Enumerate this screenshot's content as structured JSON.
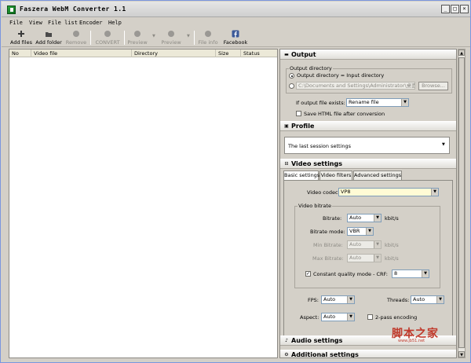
{
  "window": {
    "title": "Faszera WebM Converter 1.1",
    "controls": {
      "minimize": "_",
      "maximize": "□",
      "close": "×"
    }
  },
  "menu": [
    "File",
    "View",
    "File list",
    "Encoder",
    "Help"
  ],
  "toolbar": [
    {
      "label": "Add files",
      "icon": "plus-icon",
      "enabled": true
    },
    {
      "label": "Add folder",
      "icon": "folder-icon",
      "enabled": true
    },
    {
      "label": "Remove",
      "icon": "remove-icon",
      "enabled": false
    },
    {
      "label": "CONVERT",
      "icon": "convert-icon",
      "enabled": false
    },
    {
      "label": "Preview",
      "icon": "preview-icon",
      "enabled": false
    },
    {
      "label": "Preview",
      "icon": "preview-icon",
      "enabled": false
    },
    {
      "label": "File info",
      "icon": "info-icon",
      "enabled": false
    },
    {
      "label": "Facebook",
      "icon": "facebook-icon",
      "enabled": true
    }
  ],
  "filelist": {
    "columns": [
      "No",
      "Video file",
      "Directory",
      "Size",
      "Status"
    ]
  },
  "output": {
    "title": "Output",
    "group_title": "Output directory",
    "radio_same": "Output directory = Input directory",
    "radio_custom_value": "C:\\Documents and Settings\\Administrator\\桌面",
    "browse": "Browse...",
    "exists_label": "If output file exists:",
    "exists_value": "Rename file",
    "save_html": "Save HTML file after conversion"
  },
  "profile": {
    "title": "Profile",
    "value": "The last session settings"
  },
  "video": {
    "title": "Video settings",
    "tabs": [
      "Basic settings",
      "Video filters",
      "Advanced settings"
    ],
    "codec_label": "Video codec:",
    "codec_value": "VP8",
    "bitrate_group": "Video bitrate",
    "bitrate_label": "Bitrate:",
    "bitrate_value": "Auto",
    "bitrate_unit": "kbit/s",
    "mode_label": "Bitrate mode:",
    "mode_value": "VBR",
    "min_label": "Min Bitrate:",
    "min_value": "Auto",
    "min_unit": "kbit/s",
    "max_label": "Max Bitrate:",
    "max_value": "Auto",
    "max_unit": "kbit/s",
    "crf_label": "Constant quality mode - CRF:",
    "crf_value": "8",
    "fps_label": "FPS:",
    "fps_value": "Auto",
    "threads_label": "Threads:",
    "threads_value": "Auto",
    "aspect_label": "Aspect:",
    "aspect_value": "Auto",
    "twopass_label": "2-pass encoding"
  },
  "audio": {
    "title": "Audio settings"
  },
  "additional": {
    "title": "Additional settings"
  },
  "watermark": {
    "text": "脚本之家",
    "sub": "www.jb51.net"
  }
}
